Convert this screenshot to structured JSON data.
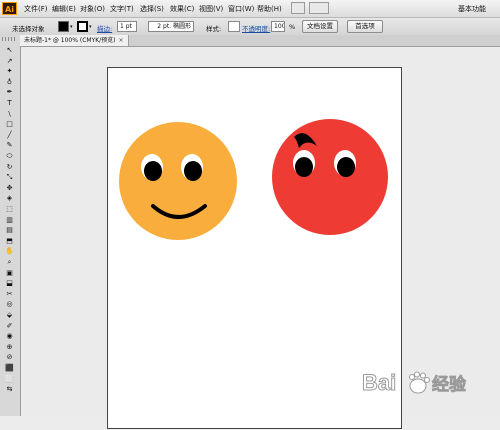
{
  "app": {
    "logo": "Ai",
    "menus": [
      "文件(F)",
      "编辑(E)",
      "对象(O)",
      "文字(T)",
      "选择(S)",
      "效果(C)",
      "视图(V)",
      "窗口(W)",
      "帮助(H)"
    ],
    "workspace": "基本功能",
    "window_buttons": [
      "—",
      "□"
    ]
  },
  "control_bar": {
    "selection_status": "未选择对象",
    "stroke_label": "描边:",
    "stroke_weight": "1 pt",
    "brush_profile": "2 pt. 椭圆形",
    "style_label": "样式:",
    "opacity_label": "不透明度:",
    "opacity_value": "100",
    "opacity_unit": "%",
    "doc_setup_button": "文档设置",
    "preferences_button": "首选项"
  },
  "document_tab": {
    "title": "未标题-1* @ 100% (CMYK/预览)",
    "close": "×"
  },
  "tools": [
    "↖",
    "↗",
    "✦",
    "♁",
    "✒",
    "T",
    "\\",
    "□",
    "╱",
    "✎",
    "⬭",
    "↻",
    "⤡",
    "✥",
    "◈",
    "⬚",
    "▥",
    "▤",
    "⬒",
    "✋",
    "⌕",
    "▣",
    "⬓",
    "✂",
    "◎",
    "⬙",
    "✐",
    "◉",
    "⊕",
    "⊘",
    "⬛",
    "⬜",
    "⇆"
  ],
  "artwork": {
    "colors": {
      "orange_face": "#f9ad3d",
      "red_face": "#ee3c35",
      "eye_white": "#ffffff",
      "pupil": "#000000",
      "mouth": "#000000"
    },
    "faces": [
      {
        "name": "smiling-face",
        "expression": "smile"
      },
      {
        "name": "angry-face",
        "expression": "frown-brow"
      }
    ]
  },
  "watermark": {
    "brand": "Bai",
    "brand_suffix": "经验"
  }
}
